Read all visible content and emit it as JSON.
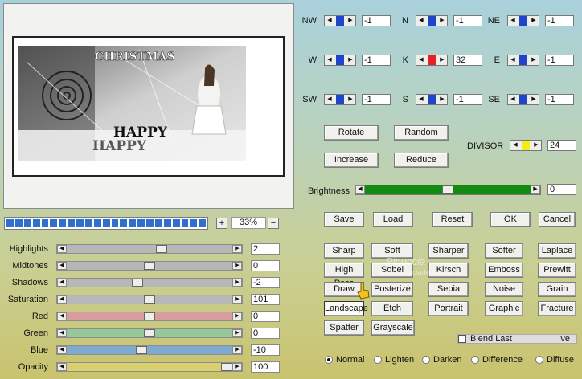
{
  "preview": {
    "artwork_text": [
      "CHRISTMAS",
      "HAPPY",
      "HAPPY"
    ]
  },
  "zoom": {
    "plus": "+",
    "minus": "−",
    "value": "33%",
    "progress_segments": 23
  },
  "sliders": [
    {
      "key": "highlights",
      "label": "Highlights",
      "value": "2",
      "level": 0.58,
      "track": "#b7b7b7"
    },
    {
      "key": "midtones",
      "label": "Midtones",
      "value": "0",
      "level": 0.5,
      "track": "#b7b7b7"
    },
    {
      "key": "shadows",
      "label": "Shadows",
      "value": "-2",
      "level": 0.42,
      "track": "#b7b7b7"
    },
    {
      "key": "saturation",
      "label": "Saturation",
      "value": "101",
      "level": 0.5,
      "track": "#b7b7b7"
    },
    {
      "key": "red",
      "label": "Red",
      "value": "0",
      "level": 0.5,
      "track": "#d79d9f"
    },
    {
      "key": "green",
      "label": "Green",
      "value": "0",
      "level": 0.5,
      "track": "#96c99a"
    },
    {
      "key": "blue",
      "label": "Blue",
      "value": "-10",
      "level": 0.45,
      "track": "#7ea9d0"
    },
    {
      "key": "opacity",
      "label": "Opacity",
      "value": "100",
      "level": 1.0,
      "track": "#d9cf6c"
    }
  ],
  "matrix": [
    {
      "key": "nw",
      "label": "NW",
      "value": "-1"
    },
    {
      "key": "n",
      "label": "N",
      "value": "-1"
    },
    {
      "key": "ne",
      "label": "NE",
      "value": "-1"
    },
    {
      "key": "w",
      "label": "W",
      "value": "-1"
    },
    {
      "key": "k",
      "label": "K",
      "value": "32"
    },
    {
      "key": "e",
      "label": "E",
      "value": "-1"
    },
    {
      "key": "sw",
      "label": "SW",
      "value": "-1"
    },
    {
      "key": "s",
      "label": "S",
      "value": "-1"
    },
    {
      "key": "se",
      "label": "SE",
      "value": "-1"
    }
  ],
  "matrix_buttons": {
    "rotate": "Rotate",
    "random": "Random",
    "increase": "Increase",
    "reduce": "Reduce"
  },
  "divisor": {
    "label": "DIVISOR",
    "value": "24"
  },
  "brightness": {
    "label": "Brightness",
    "value": "0",
    "level": 0.5,
    "color": "#138a12"
  },
  "actions": {
    "save": "Save",
    "load": "Load",
    "reset": "Reset",
    "ok": "OK",
    "cancel": "Cancel"
  },
  "presets": [
    [
      "Sharp",
      "Soft",
      "Sharper",
      "Softer",
      "Laplace"
    ],
    [
      "High Pass",
      "Sobel",
      "Kirsch",
      "Emboss",
      "Prewitt"
    ],
    [
      "Draw",
      "Posterize",
      "Sepia",
      "Noise",
      "Grain"
    ],
    [
      "Landscape",
      "Etch",
      "Portrait",
      "Graphic",
      "Fracture"
    ],
    [
      "Spatter",
      "Grayscale"
    ]
  ],
  "selected_preset": "Landscape",
  "blend_last": {
    "label": "Blend Last",
    "trailing": "ve"
  },
  "modes": [
    {
      "label": "Normal",
      "selected": true
    },
    {
      "label": "Lighten",
      "selected": false
    },
    {
      "label": "Darken",
      "selected": false
    },
    {
      "label": "Difference",
      "selected": false
    },
    {
      "label": "Diffuse",
      "selected": false
    }
  ],
  "watermark": {
    "line1": "Pinuccia",
    "line2": "www.pinucciadesign.eu"
  }
}
